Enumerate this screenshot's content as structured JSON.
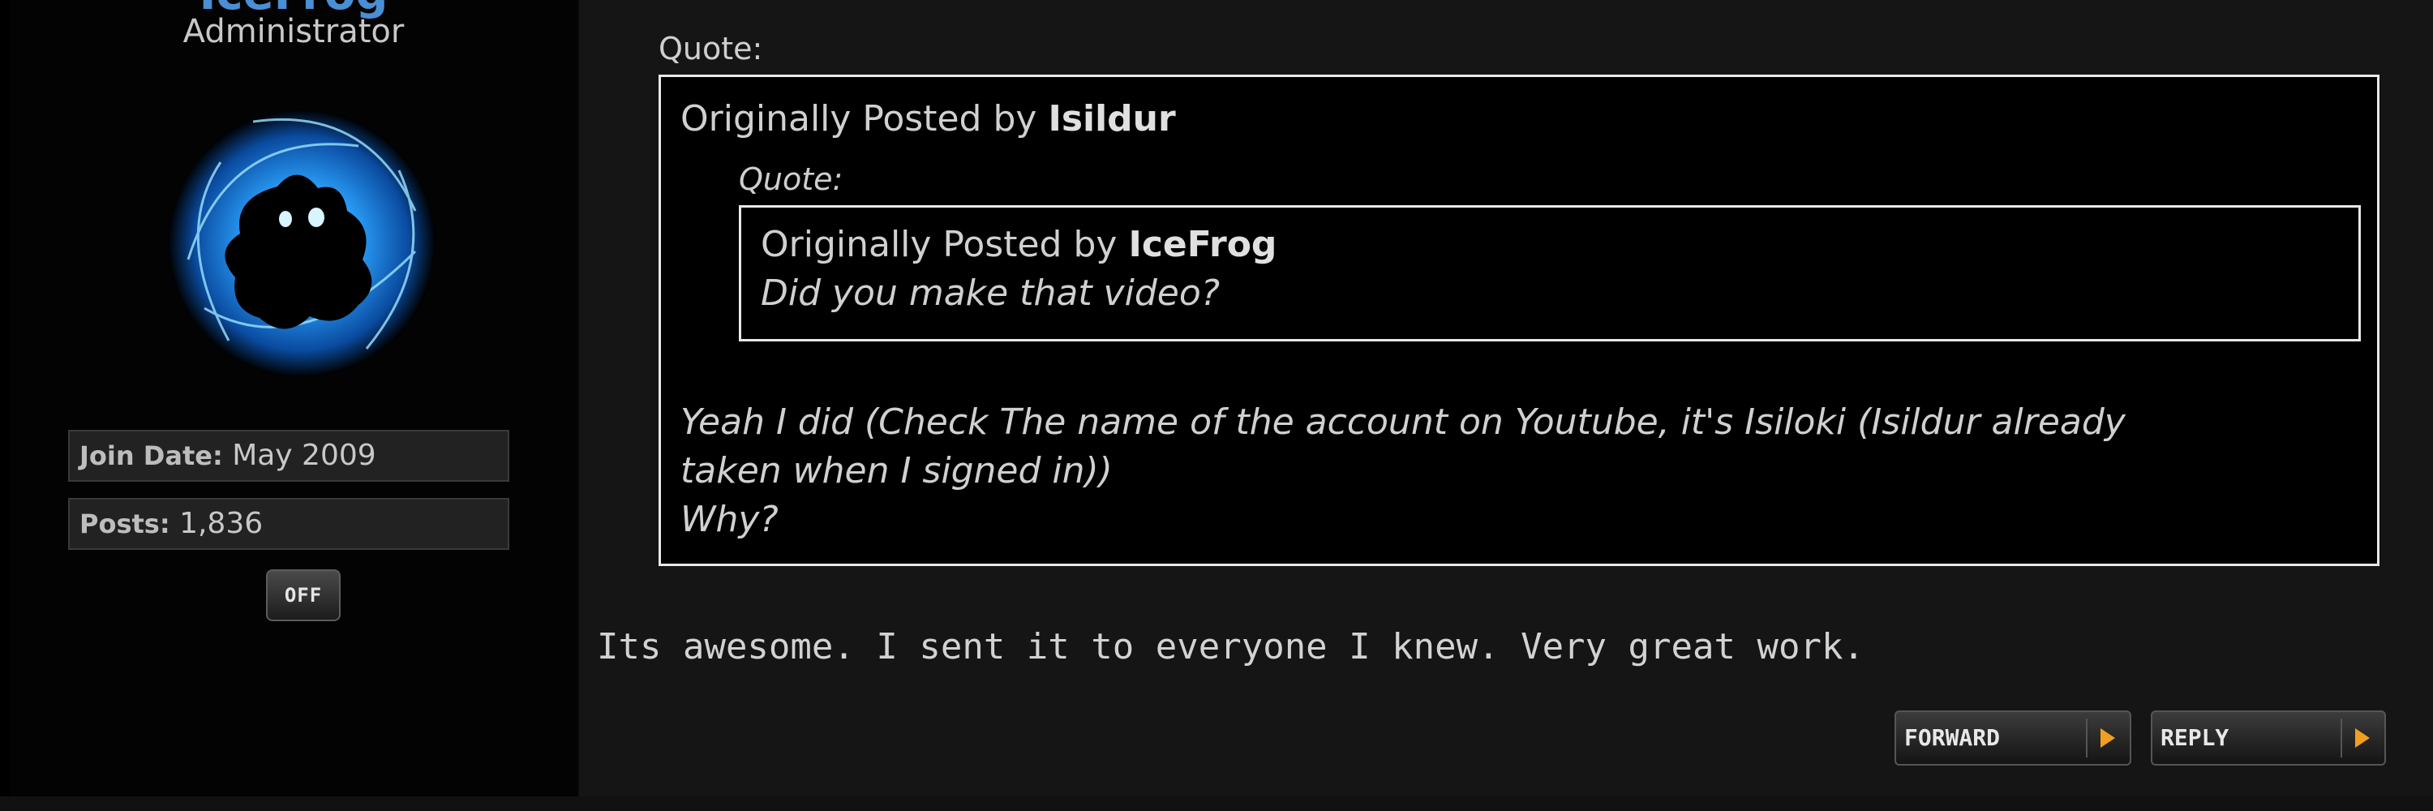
{
  "user": {
    "name": "IceFrog",
    "title": "Administrator",
    "avatar": "frog-avatar",
    "join_date_label": "Join Date:",
    "join_date": "May 2009",
    "posts_label": "Posts:",
    "posts": "1,836",
    "status_button": "OFF"
  },
  "post": {
    "quote_label": "Quote:",
    "outer_quote": {
      "prefix": "Originally Posted by",
      "author": "Isildur",
      "inner_quote_label": "Quote:",
      "inner_quote": {
        "prefix": "Originally Posted by",
        "author": "IceFrog",
        "text": "Did you make that video?"
      },
      "reply_line1": "Yeah I did (Check The name of the account on Youtube, it's Isiloki (Isildur already",
      "reply_line2": "taken when I signed in))",
      "reply_line3": "Why?"
    },
    "body": "Its awesome. I sent it to everyone I knew. Very great work."
  },
  "actions": {
    "forward": "FORWARD",
    "reply": "REPLY"
  },
  "colors": {
    "username": "#4a8ed4",
    "arrow": "#f0a020"
  }
}
